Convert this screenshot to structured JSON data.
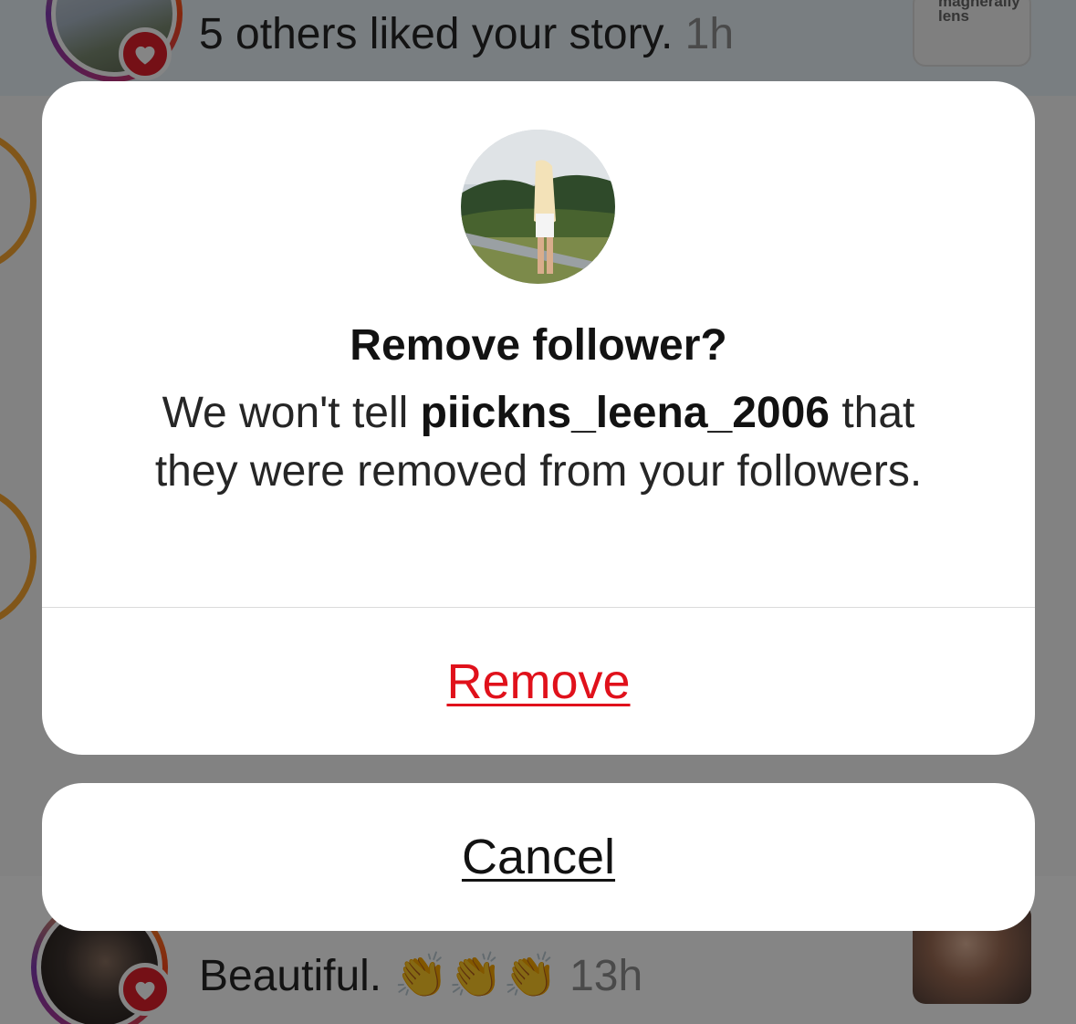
{
  "feed": {
    "top_notification": {
      "text": "5 others liked your story.",
      "time": "1h",
      "thumb_caption_line1": "magherally",
      "thumb_caption_line2": "lens"
    },
    "bottom_notification": {
      "text": "Beautiful. 👏👏👏",
      "time": "13h"
    }
  },
  "dialog": {
    "title": "Remove follower?",
    "message_prefix": "We won't tell ",
    "username": "piickns_leena_2006",
    "message_suffix": " that they were removed from your followers.",
    "remove_label": "Remove",
    "cancel_label": "Cancel"
  },
  "colors": {
    "destructive": "#e0111b",
    "badge_red": "#e0202b",
    "story_ring": "#f7a531"
  },
  "icons": [
    "heart-icon"
  ]
}
